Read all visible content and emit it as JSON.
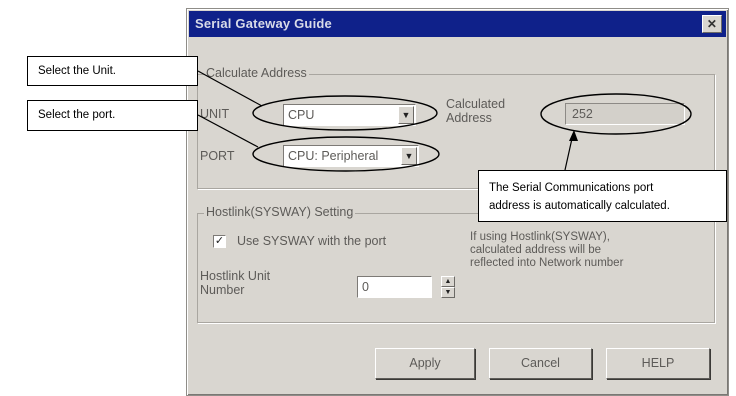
{
  "dialog": {
    "title": "Serial Gateway Guide",
    "close_glyph": "✕"
  },
  "calculate": {
    "group_title": "Calculate Address",
    "unit_label": "UNIT",
    "unit_value": "CPU",
    "port_label": "PORT",
    "port_value": "CPU: Peripheral",
    "calculated_label_line1": "Calculated",
    "calculated_label_line2": "Address",
    "calculated_value": "252"
  },
  "hostlink": {
    "group_title": "Hostlink(SYSWAY) Setting",
    "checkbox_label": "Use SYSWAY with the port",
    "checkbox_checked": true,
    "unit_number_label_line1": "Hostlink Unit",
    "unit_number_label_line2": "Number",
    "unit_number_value": "0",
    "note_line1": "If using Hostlink(SYSWAY),",
    "note_line2": "calculated address will be",
    "note_line3": "reflected into Network number"
  },
  "buttons": {
    "apply": "Apply",
    "cancel": "Cancel",
    "help": "HELP"
  },
  "callouts": {
    "select_unit": "Select the Unit.",
    "select_port": "Select the port.",
    "auto_calc_line1": "The Serial Communications port",
    "auto_calc_line2": "address is automatically calculated."
  },
  "icons": {
    "close": "close-icon",
    "dropdown": "chevron-down-icon",
    "spin_up": "spin-up-icon",
    "spin_down": "spin-down-icon",
    "check": "checkmark-icon"
  },
  "colors": {
    "titlebar": "#0f218a",
    "dialog_bg": "#d9d6d0"
  }
}
